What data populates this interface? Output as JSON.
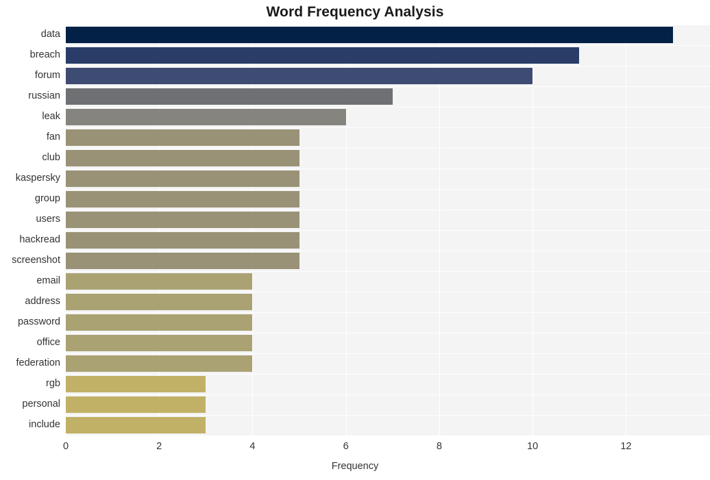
{
  "chart_data": {
    "type": "bar",
    "orientation": "horizontal",
    "title": "Word Frequency Analysis",
    "xlabel": "Frequency",
    "ylabel": "",
    "categories": [
      "data",
      "breach",
      "forum",
      "russian",
      "leak",
      "fan",
      "club",
      "kaspersky",
      "group",
      "users",
      "hackread",
      "screenshot",
      "email",
      "address",
      "password",
      "office",
      "federation",
      "rgb",
      "personal",
      "include"
    ],
    "values": [
      13,
      11,
      10,
      7,
      6,
      5,
      5,
      5,
      5,
      5,
      5,
      5,
      4,
      4,
      4,
      4,
      4,
      3,
      3,
      3
    ],
    "bar_colors": [
      "#032147",
      "#2a3d६9",
      "#3e4b72",
      "#6e7073",
      "#86847e",
      "#999276",
      "#999276",
      "#999276",
      "#999276",
      "#999276",
      "#999276",
      "#999276",
      "#aba274",
      "#aba274",
      "#aba274",
      "#aba274",
      "#aba274",
      "#c0b166",
      "#c0b166",
      "#c0b166"
    ],
    "xlim": [
      0,
      13.8
    ],
    "xticks": [
      0,
      2,
      4,
      6,
      8,
      10,
      12
    ],
    "xtick_labels": [
      "0",
      "2",
      "4",
      "6",
      "8",
      "10",
      "12"
    ],
    "grid": true,
    "grid_color": "#ffffff",
    "plot_background": "#f4f4f5",
    "figure_background": "#ffffff",
    "legend": null
  },
  "colors": {
    "title_color": "#1a1a1a",
    "tick_color": "#333333",
    "palette": [
      "#032147",
      "#2a3d69",
      "#3e4b72",
      "#6e7073",
      "#86847e",
      "#999276",
      "#999276",
      "#999276",
      "#999276",
      "#999276",
      "#999276",
      "#999276",
      "#aba274",
      "#aba274",
      "#aba274",
      "#aba274",
      "#aba274",
      "#c0b166",
      "#c0b166",
      "#c0b166"
    ]
  }
}
